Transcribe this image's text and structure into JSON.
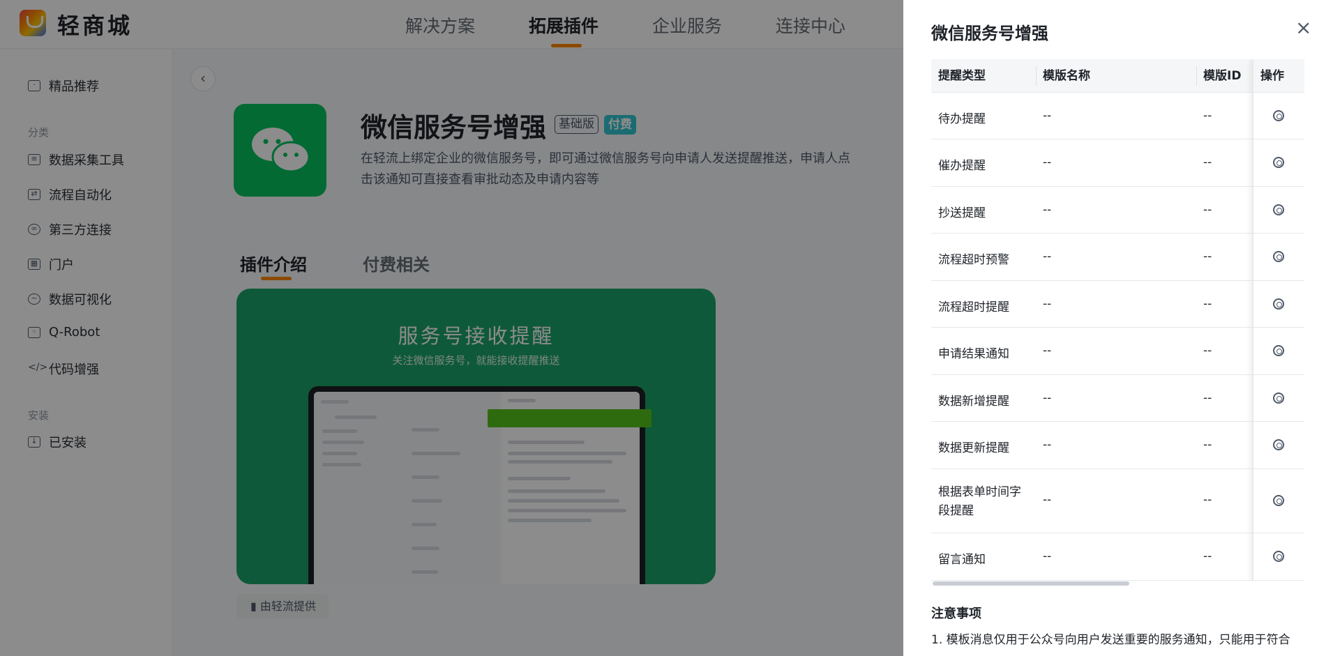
{
  "header": {
    "brand": "轻商城",
    "nav": [
      "解决方案",
      "拓展插件",
      "企业服务",
      "连接中心"
    ],
    "active_nav": "拓展插件",
    "accent_color": "#ff8800"
  },
  "sidebar": {
    "featured": "精品推荐",
    "group_category": "分类",
    "categories": [
      "数据采集工具",
      "流程自动化",
      "第三方连接",
      "门户",
      "数据可视化",
      "Q-Robot",
      "代码增强"
    ],
    "group_install": "安装",
    "installed": "已安装"
  },
  "plugin": {
    "title": "微信服务号增强",
    "badge_basic": "基础版",
    "badge_paid": "付费",
    "description": "在轻流上绑定企业的微信服务号，即可通过微信服务号向申请人发送提醒推送，申请人点击该通知可直接查看审批动态及申请内容等",
    "tabs": [
      "插件介绍",
      "付费相关"
    ],
    "active_tab": "插件介绍",
    "banner_title": "服务号接收提醒",
    "banner_subtitle": "关注微信服务号，就能接收提醒推送",
    "provider": "由轻流提供",
    "icon_color": "#07c160"
  },
  "drawer": {
    "title": "微信服务号增强",
    "columns": [
      "提醒类型",
      "模版名称",
      "模版ID",
      "操作"
    ],
    "rows": [
      {
        "type": "待办提醒",
        "name": "--",
        "id": "--"
      },
      {
        "type": "催办提醒",
        "name": "--",
        "id": "--"
      },
      {
        "type": "抄送提醒",
        "name": "--",
        "id": "--"
      },
      {
        "type": "流程超时预警",
        "name": "--",
        "id": "--"
      },
      {
        "type": "流程超时提醒",
        "name": "--",
        "id": "--"
      },
      {
        "type": "申请结果通知",
        "name": "--",
        "id": "--"
      },
      {
        "type": "数据新增提醒",
        "name": "--",
        "id": "--"
      },
      {
        "type": "数据更新提醒",
        "name": "--",
        "id": "--"
      },
      {
        "type": "根据表单时间字段提醒",
        "name": "--",
        "id": "--"
      },
      {
        "type": "留言通知",
        "name": "--",
        "id": "--"
      }
    ],
    "row_action_icon": "settings-icon",
    "notes_title": "注意事项",
    "notes_text": "1. 模板消息仅用于公众号向用户发送重要的服务通知，只能用于符合"
  }
}
